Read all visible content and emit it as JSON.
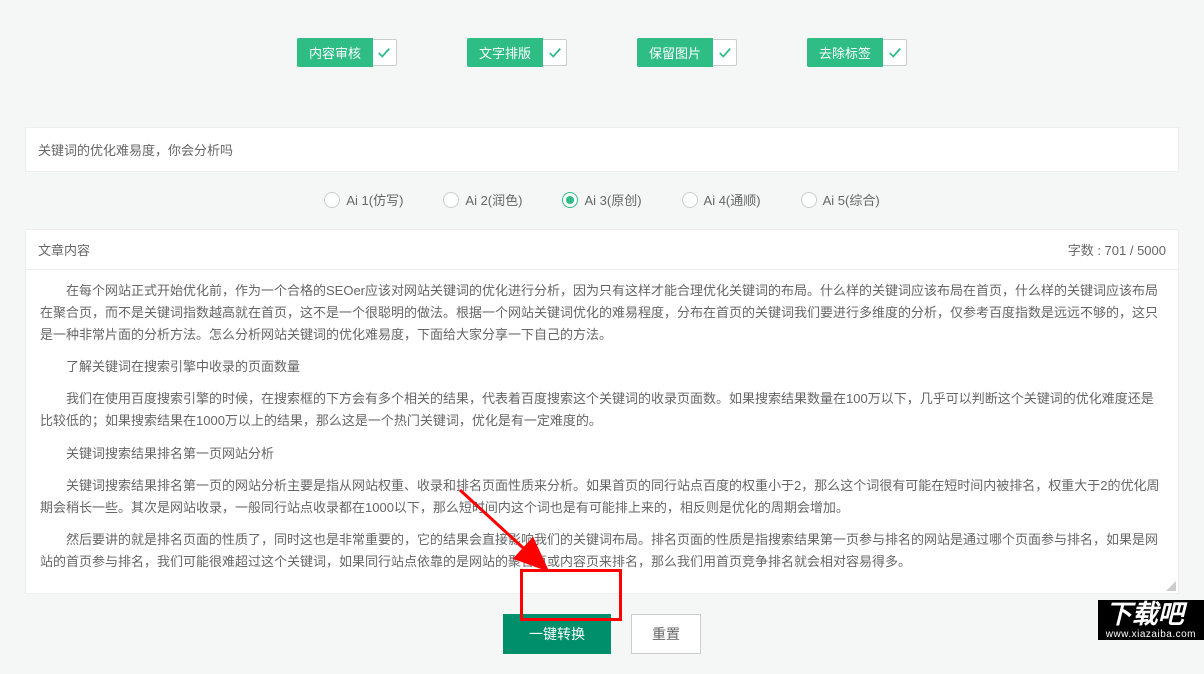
{
  "checkboxes": [
    {
      "label": "内容审核"
    },
    {
      "label": "文字排版"
    },
    {
      "label": "保留图片"
    },
    {
      "label": "去除标签"
    }
  ],
  "title_input": "关键词的优化难易度，你会分析吗",
  "radios": [
    {
      "label": "Ai 1(仿写)",
      "checked": false
    },
    {
      "label": "Ai 2(润色)",
      "checked": false
    },
    {
      "label": "Ai 3(原创)",
      "checked": true
    },
    {
      "label": "Ai 4(通顺)",
      "checked": false
    },
    {
      "label": "Ai 5(综合)",
      "checked": false
    }
  ],
  "content_header": {
    "left": "文章内容",
    "right": "字数 : 701 / 5000"
  },
  "content": {
    "p1": "在每个网站正式开始优化前，作为一个合格的SEOer应该对网站关键词的优化进行分析，因为只有这样才能合理优化关键词的布局。什么样的关键词应该布局在首页，什么样的关键词应该布局在聚合页，而不是关键词指数越高就在首页，这不是一个很聪明的做法。根据一个网站关键词优化的难易程度，分布在首页的关键词我们要进行多维度的分析，仅参考百度指数是远远不够的，这只是一种非常片面的分析方法。怎么分析网站关键词的优化难易度，下面给大家分享一下自己的方法。",
    "p2": "了解关键词在搜索引擎中收录的页面数量",
    "p3": "我们在使用百度搜索引擎的时候，在搜索框的下方会有多个相关的结果，代表着百度搜索这个关键词的收录页面数。如果搜索结果数量在100万以下，几乎可以判断这个关键词的优化难度还是比较低的；如果搜索结果在1000万以上的结果，那么这是一个热门关键词，优化是有一定难度的。",
    "p4": "关键词搜索结果排名第一页网站分析",
    "p5": "关键词搜索结果排名第一页的网站分析主要是指从网站权重、收录和排名页面性质来分析。如果首页的同行站点百度的权重小于2，那么这个词很有可能在短时间内被排名，权重大于2的优化周期会稍长一些。其次是网站收录，一般同行站点收录都在1000以下，那么短时间内这个词也是有可能排上来的，相反则是优化的周期会增加。",
    "p6": "然后要讲的就是排名页面的性质了，同时这也是非常重要的，它的结果会直接影响我们的关键词布局。排名页面的性质是指搜索结果第一页参与排名的网站是通过哪个页面参与排名，如果是网站的首页参与排名，我们可能很难超过这个关键词，如果同行站点依靠的是网站的聚合页或内容页来排名，那么我们用首页竞争排名就会相对容易得多。"
  },
  "buttons": {
    "convert": "一键转换",
    "reset": "重置"
  },
  "watermark": {
    "text": "下载吧",
    "url": "www.xiazaiba.com"
  }
}
